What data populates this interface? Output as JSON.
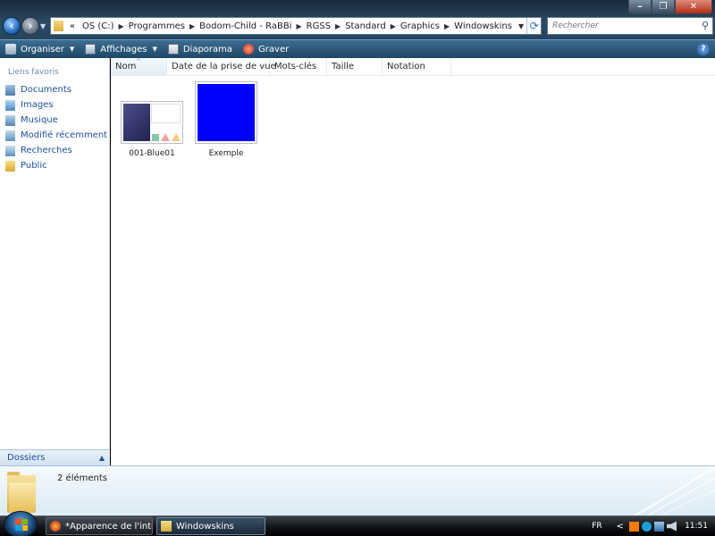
{
  "window": {
    "controls": {
      "minimize": "–",
      "maximize": "❐",
      "close": "✕"
    }
  },
  "address_bar": {
    "overflow": "«",
    "crumbs": [
      "OS (C:)",
      "Programmes",
      "Bodom-Child - RaBBi",
      "RGSS",
      "Standard",
      "Graphics",
      "Windowskins"
    ]
  },
  "search": {
    "placeholder": "Rechercher"
  },
  "toolbar": {
    "organiser": "Organiser",
    "affichages": "Affichages",
    "diaporama": "Diaporama",
    "graver": "Graver",
    "help": "?"
  },
  "sidebar": {
    "heading": "Liens favoris",
    "items": [
      {
        "label": "Documents",
        "icon": "documents-icon"
      },
      {
        "label": "Images",
        "icon": "pictures-icon"
      },
      {
        "label": "Musique",
        "icon": "music-icon"
      },
      {
        "label": "Modifié récemment",
        "icon": "recent-icon"
      },
      {
        "label": "Recherches",
        "icon": "searches-icon"
      },
      {
        "label": "Public",
        "icon": "public-folder-icon"
      }
    ],
    "folders_label": "Dossiers"
  },
  "columns": [
    "Nom",
    "Date de la prise de vue",
    "Mots-clés",
    "Taille",
    "Notation"
  ],
  "files": [
    {
      "name": "001-Blue01"
    },
    {
      "name": "Exemple",
      "color": "#0000ff"
    }
  ],
  "details": {
    "count": "2 éléments"
  },
  "taskbar": {
    "tasks": [
      "*Apparence de l'inte...",
      "Windowskins"
    ],
    "language": "FR",
    "clock": "11:51"
  }
}
